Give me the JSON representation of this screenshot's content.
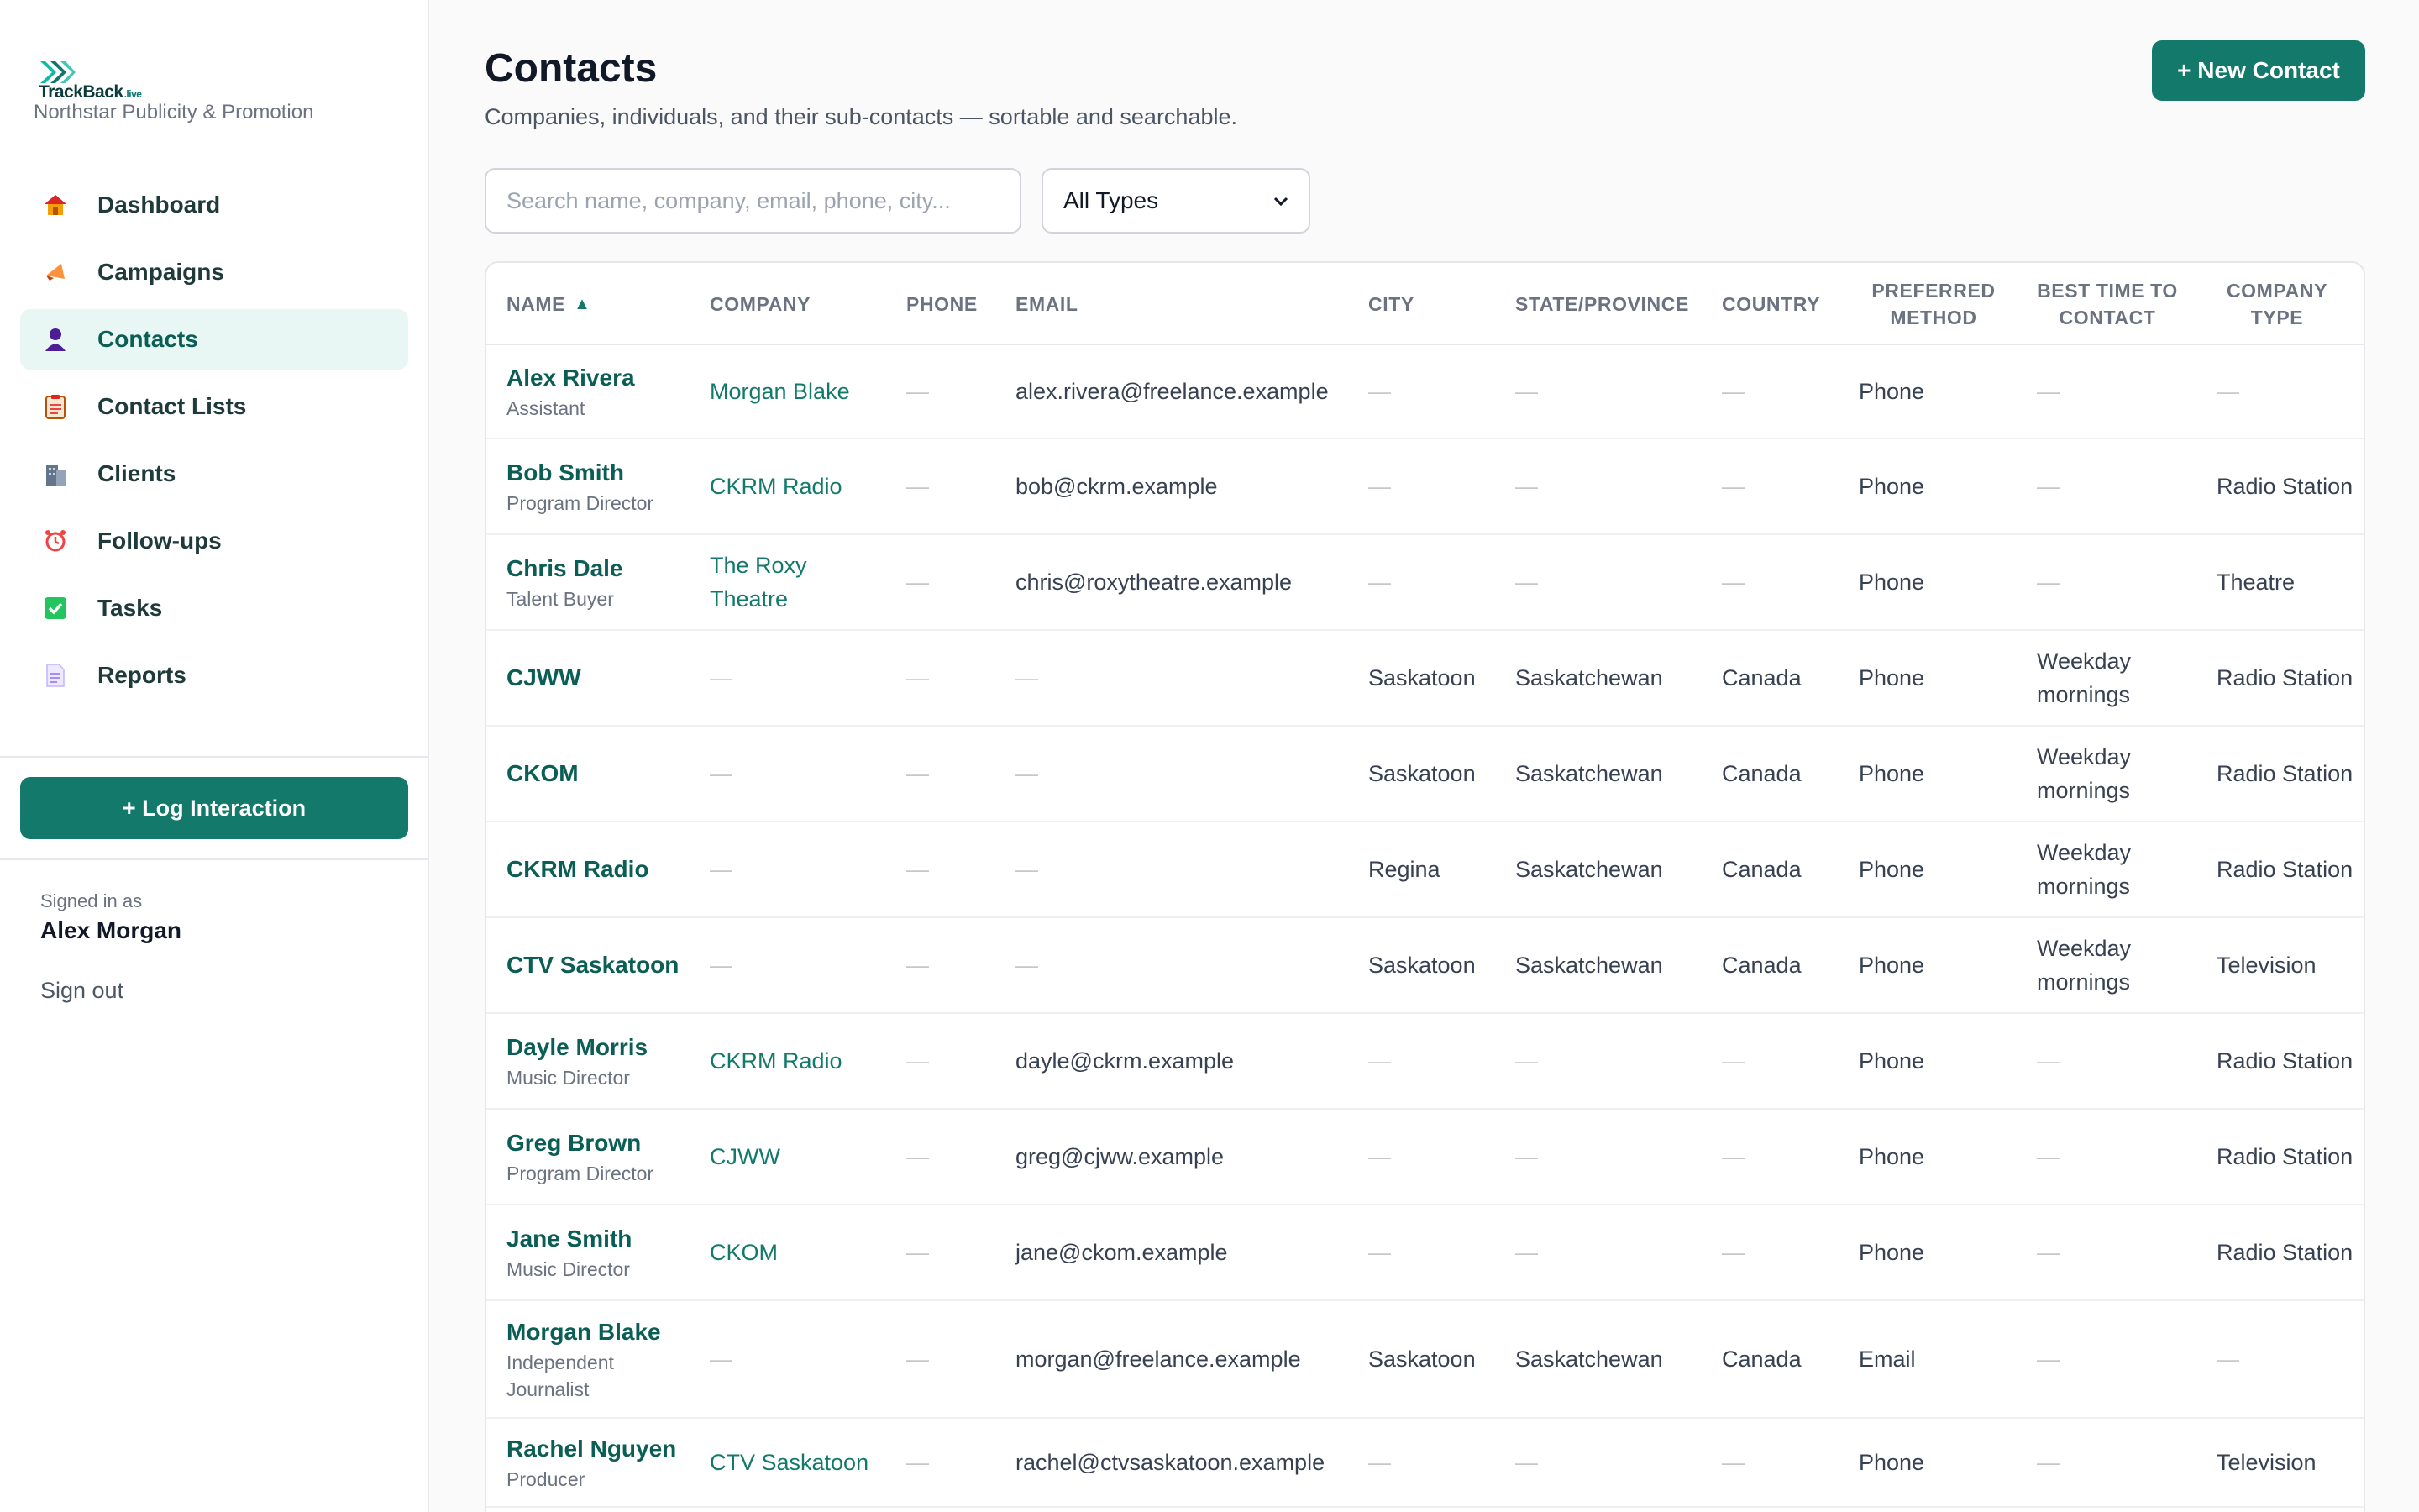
{
  "brand": {
    "name": "TrackBack",
    "suffix": ".live"
  },
  "org": "Northstar Publicity & Promotion",
  "nav": [
    {
      "label": "Dashboard",
      "icon": "house-icon"
    },
    {
      "label": "Campaigns",
      "icon": "megaphone-icon"
    },
    {
      "label": "Contacts",
      "icon": "person-icon",
      "active": true
    },
    {
      "label": "Contact Lists",
      "icon": "clipboard-icon"
    },
    {
      "label": "Clients",
      "icon": "building-icon"
    },
    {
      "label": "Follow-ups",
      "icon": "alarm-clock-icon"
    },
    {
      "label": "Tasks",
      "icon": "checkbox-icon"
    },
    {
      "label": "Reports",
      "icon": "document-icon"
    }
  ],
  "log_interaction": "+ Log Interaction",
  "user": {
    "signed_in_label": "Signed in as",
    "name": "Alex Morgan",
    "sign_out": "Sign out"
  },
  "page": {
    "title": "Contacts",
    "subtitle": "Companies, individuals, and their sub-contacts — sortable and searchable.",
    "new_button": "+ New Contact"
  },
  "search": {
    "placeholder": "Search name, company, email, phone, city..."
  },
  "type_filter": {
    "value": "All Types"
  },
  "accent": "#137a6b",
  "table": {
    "columns": [
      "Name",
      "Company",
      "Phone",
      "Email",
      "City",
      "State/Province",
      "Country",
      "Preferred Method",
      "Best time to contact",
      "Company Type"
    ],
    "sort_indicator": "▲",
    "rows": [
      {
        "name": "Alex Rivera",
        "role": "Assistant",
        "company": "Morgan Blake",
        "phone": "—",
        "email": "alex.rivera@freelance.example",
        "city": "—",
        "state": "—",
        "country": "—",
        "method": "Phone",
        "best_time": "—",
        "type": "—"
      },
      {
        "name": "Bob Smith",
        "role": "Program Director",
        "company": "CKRM Radio",
        "phone": "—",
        "email": "bob@ckrm.example",
        "city": "—",
        "state": "—",
        "country": "—",
        "method": "Phone",
        "best_time": "—",
        "type": "Radio Station"
      },
      {
        "name": "Chris Dale",
        "role": "Talent Buyer",
        "company": "The Roxy Theatre",
        "phone": "—",
        "email": "chris@roxytheatre.example",
        "city": "—",
        "state": "—",
        "country": "—",
        "method": "Phone",
        "best_time": "—",
        "type": "Theatre"
      },
      {
        "name": "CJWW",
        "role": "",
        "company": "—",
        "phone": "—",
        "email": "—",
        "city": "Saskatoon",
        "state": "Saskatchewan",
        "country": "Canada",
        "method": "Phone",
        "best_time": "Weekday mornings",
        "type": "Radio Station"
      },
      {
        "name": "CKOM",
        "role": "",
        "company": "—",
        "phone": "—",
        "email": "—",
        "city": "Saskatoon",
        "state": "Saskatchewan",
        "country": "Canada",
        "method": "Phone",
        "best_time": "Weekday mornings",
        "type": "Radio Station"
      },
      {
        "name": "CKRM Radio",
        "role": "",
        "company": "—",
        "phone": "—",
        "email": "—",
        "city": "Regina",
        "state": "Saskatchewan",
        "country": "Canada",
        "method": "Phone",
        "best_time": "Weekday mornings",
        "type": "Radio Station"
      },
      {
        "name": "CTV Saskatoon",
        "role": "",
        "company": "—",
        "phone": "—",
        "email": "—",
        "city": "Saskatoon",
        "state": "Saskatchewan",
        "country": "Canada",
        "method": "Phone",
        "best_time": "Weekday mornings",
        "type": "Television"
      },
      {
        "name": "Dayle Morris",
        "role": "Music Director",
        "company": "CKRM Radio",
        "phone": "—",
        "email": "dayle@ckrm.example",
        "city": "—",
        "state": "—",
        "country": "—",
        "method": "Phone",
        "best_time": "—",
        "type": "Radio Station"
      },
      {
        "name": "Greg Brown",
        "role": "Program Director",
        "company": "CJWW",
        "phone": "—",
        "email": "greg@cjww.example",
        "city": "—",
        "state": "—",
        "country": "—",
        "method": "Phone",
        "best_time": "—",
        "type": "Radio Station"
      },
      {
        "name": "Jane Smith",
        "role": "Music Director",
        "company": "CKOM",
        "phone": "—",
        "email": "jane@ckom.example",
        "city": "—",
        "state": "—",
        "country": "—",
        "method": "Phone",
        "best_time": "—",
        "type": "Radio Station"
      },
      {
        "name": "Morgan Blake",
        "role": "Independent Journalist",
        "company": "—",
        "phone": "—",
        "email": "morgan@freelance.example",
        "city": "Saskatoon",
        "state": "Saskatchewan",
        "country": "Canada",
        "method": "Email",
        "best_time": "—",
        "type": "—"
      },
      {
        "name": "Rachel Nguyen",
        "role": "Producer",
        "company": "CTV Saskatoon",
        "phone": "—",
        "email": "rachel@ctvsaskatoon.example",
        "city": "—",
        "state": "—",
        "country": "—",
        "method": "Phone",
        "best_time": "—",
        "type": "Television"
      }
    ]
  }
}
